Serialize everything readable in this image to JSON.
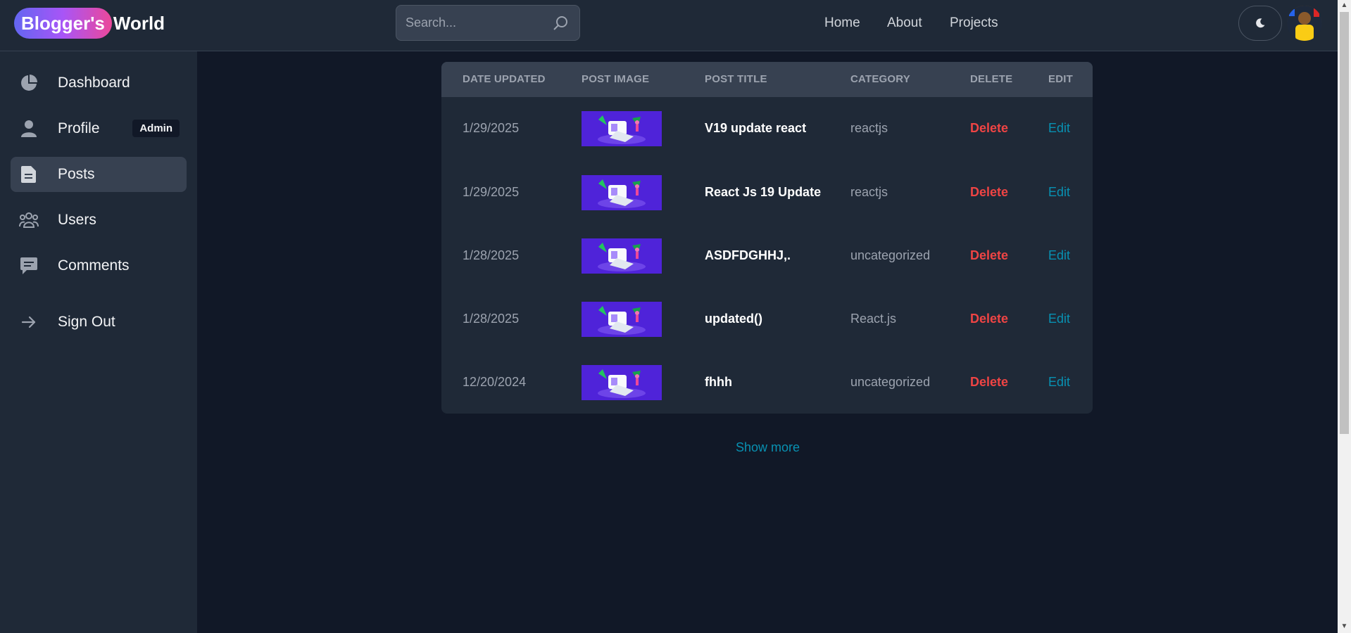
{
  "header": {
    "logo_highlight": "Blogger's",
    "logo_rest": "World",
    "search_placeholder": "Search...",
    "nav": [
      "Home",
      "About",
      "Projects"
    ],
    "theme_icon": "moon-icon",
    "avatar_icon": "user-avatar"
  },
  "sidebar": {
    "items": [
      {
        "label": "Dashboard",
        "icon": "pie-chart-icon"
      },
      {
        "label": "Profile",
        "icon": "user-icon",
        "badge": "Admin"
      },
      {
        "label": "Posts",
        "icon": "document-icon",
        "active": true
      },
      {
        "label": "Users",
        "icon": "users-group-icon"
      },
      {
        "label": "Comments",
        "icon": "comment-icon"
      },
      {
        "label": "Sign Out",
        "icon": "arrow-right-icon"
      }
    ]
  },
  "table": {
    "headers": [
      "DATE UPDATED",
      "POST IMAGE",
      "POST TITLE",
      "CATEGORY",
      "DELETE",
      "EDIT"
    ],
    "rows": [
      {
        "date": "1/29/2025",
        "title": "V19 update react",
        "category": "reactjs",
        "delete": "Delete",
        "edit": "Edit"
      },
      {
        "date": "1/29/2025",
        "title": "React Js 19 Update",
        "category": "reactjs",
        "delete": "Delete",
        "edit": "Edit"
      },
      {
        "date": "1/28/2025",
        "title": "ASDFDGHHJ,.",
        "category": "uncategorized",
        "delete": "Delete",
        "edit": "Edit"
      },
      {
        "date": "1/28/2025",
        "title": "updated()",
        "category": "React.js",
        "delete": "Delete",
        "edit": "Edit"
      },
      {
        "date": "12/20/2024",
        "title": "fhhh",
        "category": "uncategorized",
        "delete": "Delete",
        "edit": "Edit"
      }
    ]
  },
  "show_more": "Show more",
  "colors": {
    "background": "#111827",
    "panel": "#1f2937",
    "delete": "#ef4444",
    "edit": "#0891b2"
  }
}
